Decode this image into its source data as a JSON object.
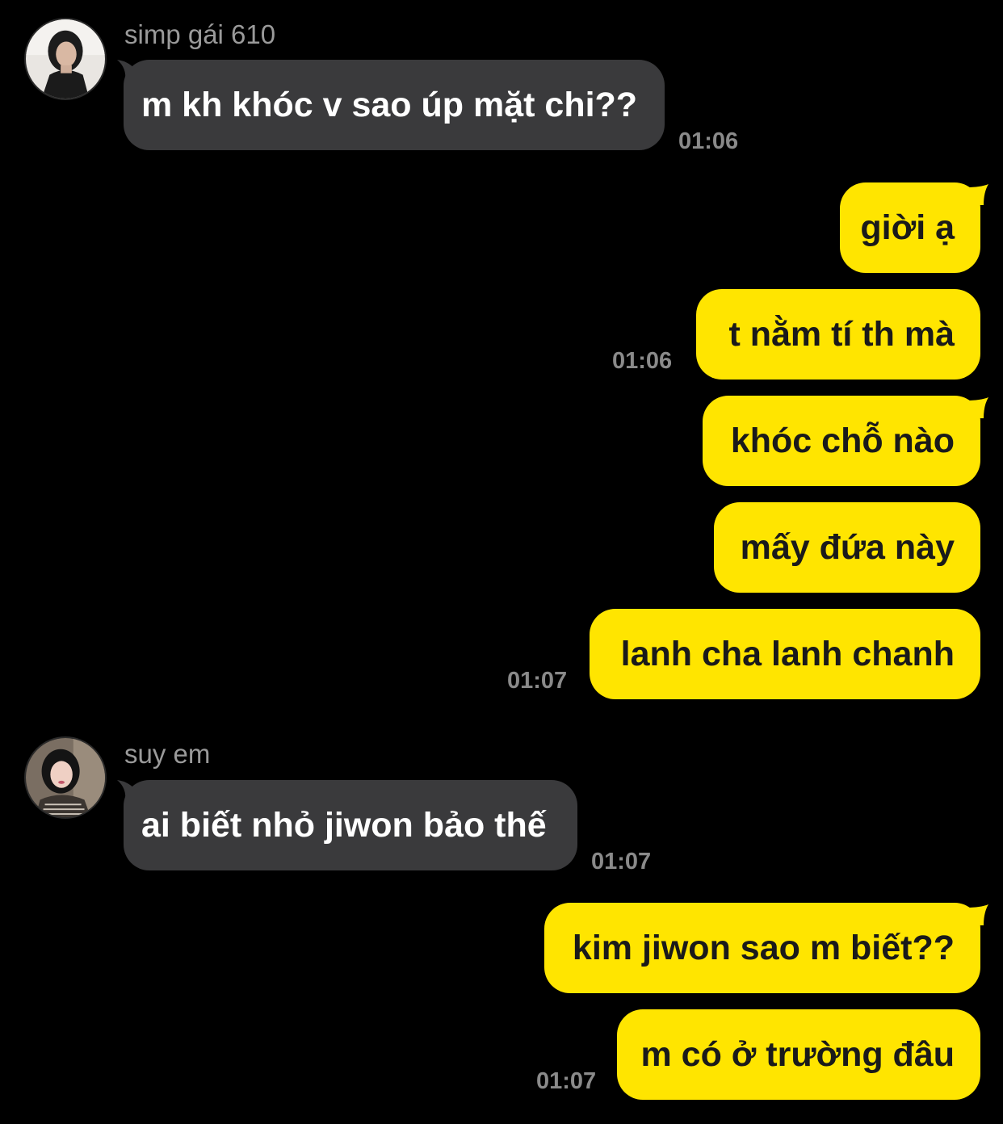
{
  "messages": [
    {
      "sender": "simp gái 610",
      "text": "m kh khóc v sao úp mặt chi??",
      "time": "01:06",
      "direction": "incoming",
      "avatar_icon": "profile-photo-avatar"
    },
    {
      "text": "giời ạ",
      "direction": "outgoing"
    },
    {
      "text": "t nằm tí th mà",
      "time": "01:06",
      "direction": "outgoing"
    },
    {
      "text": "khóc chỗ nào",
      "direction": "outgoing"
    },
    {
      "text": "mấy đứa này",
      "direction": "outgoing"
    },
    {
      "text": "lanh cha lanh chanh",
      "time": "01:07",
      "direction": "outgoing"
    },
    {
      "sender": "suy em",
      "text": "ai biết nhỏ jiwon bảo thế",
      "time": "01:07",
      "direction": "incoming",
      "avatar_icon": "profile-photo-avatar"
    },
    {
      "text": "kim jiwon sao m biết??",
      "direction": "outgoing"
    },
    {
      "text": "m có ở trường đâu",
      "time": "01:07",
      "direction": "outgoing"
    }
  ],
  "colors": {
    "background": "#000000",
    "incoming_bubble": "#3a3a3c",
    "outgoing_bubble": "#ffe500",
    "sender_name": "#9a9a9a",
    "timestamp": "#8a8a8a"
  }
}
